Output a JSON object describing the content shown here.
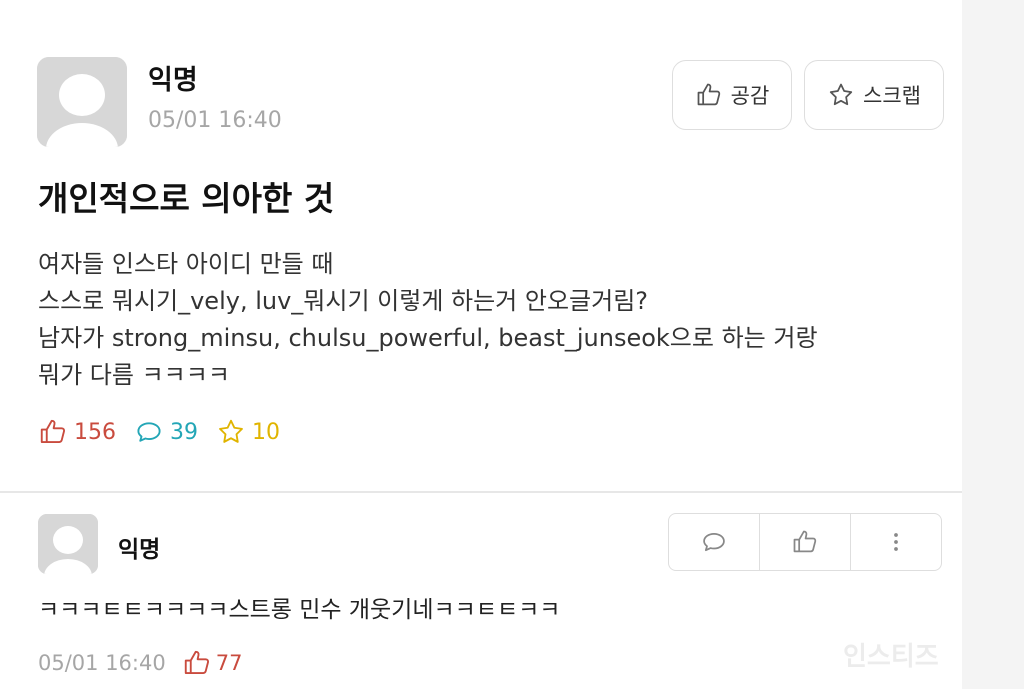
{
  "post": {
    "author": "익명",
    "time": "05/01 16:40",
    "buttons": {
      "like_label": "공감",
      "scrap_label": "스크랩"
    },
    "title": "개인적으로 의아한 것",
    "body_lines": [
      "여자들 인스타 아이디 만들 때",
      "스스로 뭐시기_vely, luv_뭐시기 이렇게 하는거 안오글거림?",
      "남자가 strong_minsu, chulsu_powerful, beast_junseok으로 하는 거랑",
      "뭐가 다름 ㅋㅋㅋㅋ"
    ],
    "stats": {
      "likes": "156",
      "comments": "39",
      "scraps": "10"
    }
  },
  "comment": {
    "author": "익명",
    "text": "ㅋㅋㅋㅌㅌㅋㅋㅋㅋ스트롱 민수 개웃기네ㅋㅋㅌㅌㅋㅋ",
    "time": "05/01 16:40",
    "likes": "77"
  },
  "watermark": "인스티즈",
  "icons": {
    "avatar": "default-user-avatar-icon",
    "like": "thumbs-up-icon",
    "scrap": "star-icon",
    "comment": "speech-bubble-icon",
    "more": "vertical-ellipsis-icon"
  },
  "colors": {
    "like": "#c94b3e",
    "comment": "#23a6b6",
    "scrap": "#e0b400",
    "muted": "#a6a6a6",
    "avatar_bg": "#d7d7d7"
  }
}
